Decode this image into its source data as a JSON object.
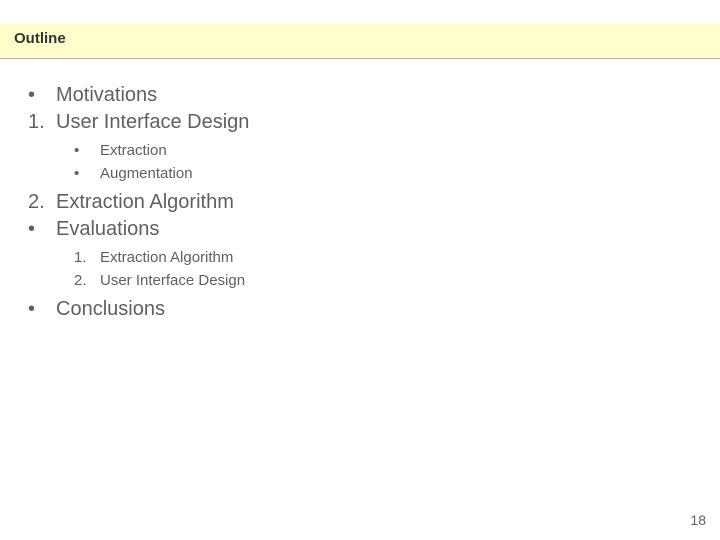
{
  "title": "Outline",
  "items": [
    {
      "level": 1,
      "marker": "•",
      "text": "Motivations"
    },
    {
      "level": 1,
      "marker": "1.",
      "text": "User Interface Design"
    },
    {
      "level": 2,
      "marker": "•",
      "text": "Extraction"
    },
    {
      "level": 2,
      "marker": "•",
      "text": "Augmentation"
    },
    {
      "level": 1,
      "marker": "2.",
      "text": "Extraction Algorithm"
    },
    {
      "level": 1,
      "marker": "•",
      "text": "Evaluations"
    },
    {
      "level": 2,
      "marker": "1.",
      "text": "Extraction Algorithm"
    },
    {
      "level": 2,
      "marker": "2.",
      "text": "User Interface Design"
    },
    {
      "level": 1,
      "marker": "•",
      "text": "Conclusions"
    }
  ],
  "page_number": "18"
}
